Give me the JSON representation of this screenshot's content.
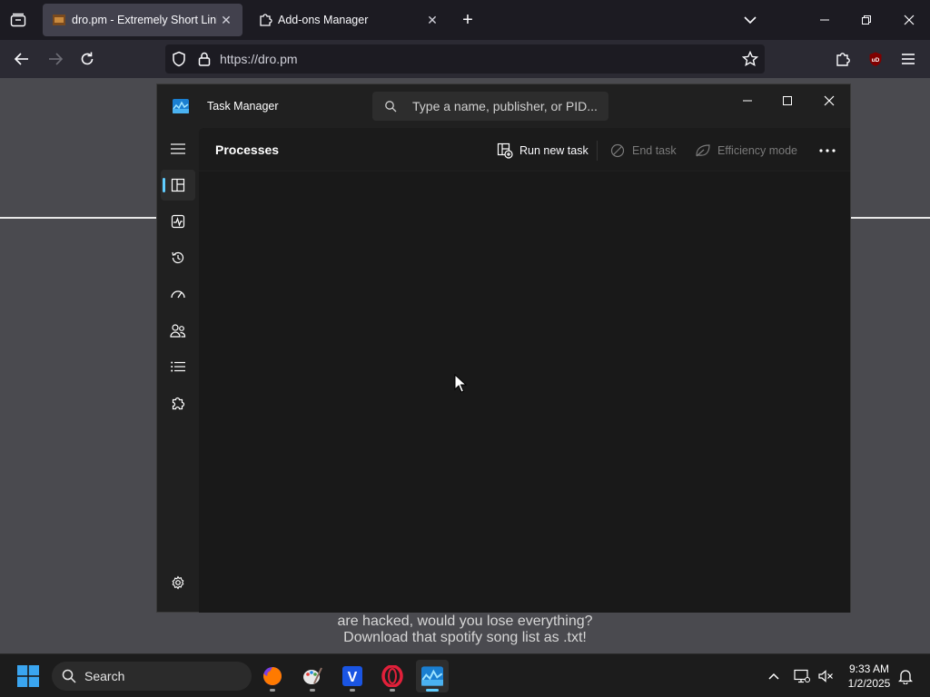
{
  "browser": {
    "tabs": [
      {
        "title": "dro.pm - Extremely Short Links",
        "active": true
      },
      {
        "title": "Add-ons Manager",
        "active": false
      }
    ],
    "url": "https://dro.pm"
  },
  "page": {
    "line1": "are hacked, would you lose everything?",
    "line2": "Download that spotify song list as .txt!"
  },
  "task_manager": {
    "title": "Task Manager",
    "search_placeholder": "Type a name, publisher, or PID...",
    "page_title": "Processes",
    "toolbar": {
      "run_new_task": "Run new task",
      "end_task": "End task",
      "efficiency_mode": "Efficiency mode"
    },
    "accent": "#60cdff"
  },
  "taskbar": {
    "search_label": "Search",
    "time": "9:33 AM",
    "date": "1/2/2025"
  }
}
